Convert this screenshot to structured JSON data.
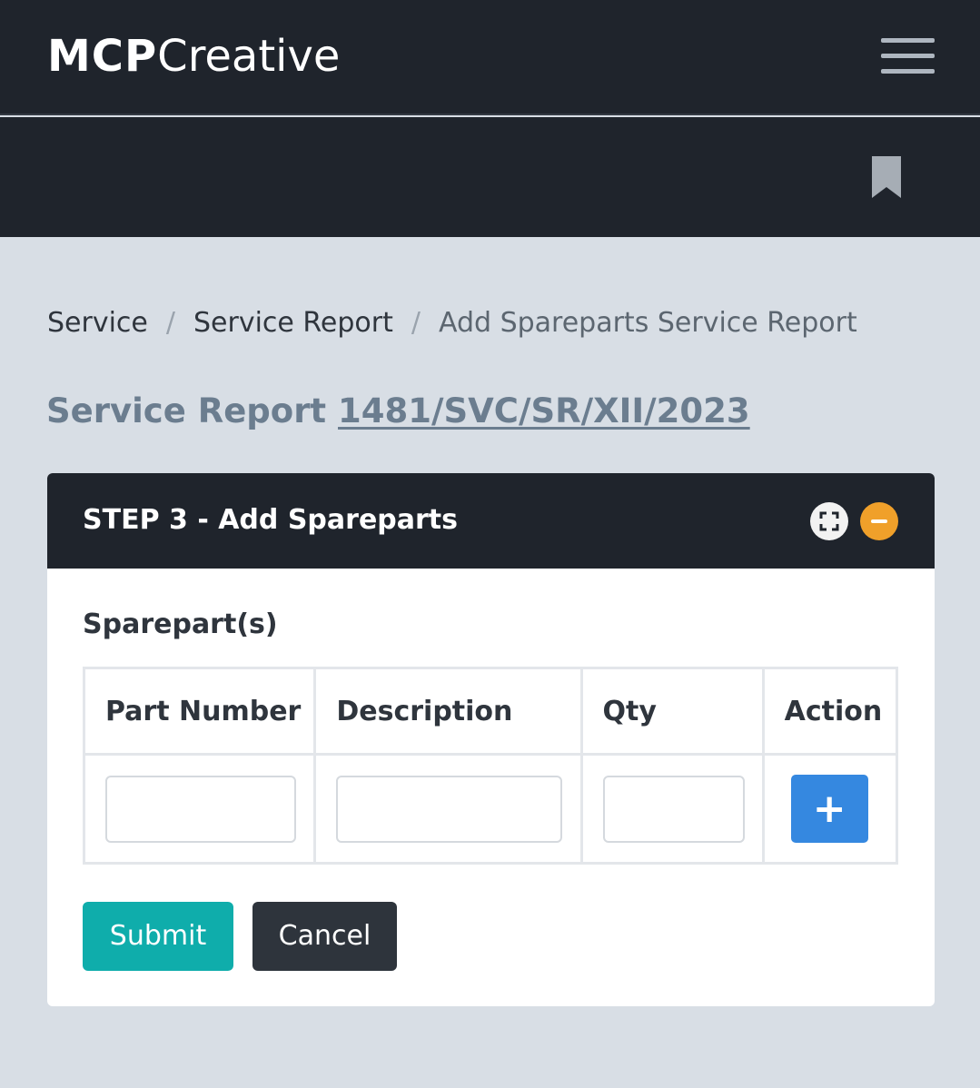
{
  "brand": {
    "bold": "MCP",
    "light": "Creative"
  },
  "nav": {
    "menu_icon": "hamburger-menu-icon",
    "bookmark_icon": "bookmark-icon"
  },
  "breadcrumb": {
    "items": [
      "Service",
      "Service Report"
    ],
    "current": "Add Spareparts Service Report",
    "separator": "/"
  },
  "report": {
    "label": "Service Report",
    "number": "1481/SVC/SR/XII/2023"
  },
  "card": {
    "title": "STEP 3 - Add Spareparts",
    "tools": {
      "expand_icon": "fullscreen-icon",
      "collapse_icon": "minus-circle-icon"
    }
  },
  "spareparts": {
    "label": "Sparepart(s)",
    "columns": [
      "Part Number",
      "Description",
      "Qty",
      "Action"
    ],
    "row": {
      "part_number": "",
      "description": "",
      "qty": "",
      "add_label": "+"
    }
  },
  "actions": {
    "submit": "Submit",
    "cancel": "Cancel"
  },
  "colors": {
    "navbar": "#1f242c",
    "background": "#d8dee5",
    "title": "#6b7d8f",
    "submit": "#0fadab",
    "cancel": "#2e343c",
    "add": "#3588e0",
    "collapse": "#f0a02a"
  }
}
